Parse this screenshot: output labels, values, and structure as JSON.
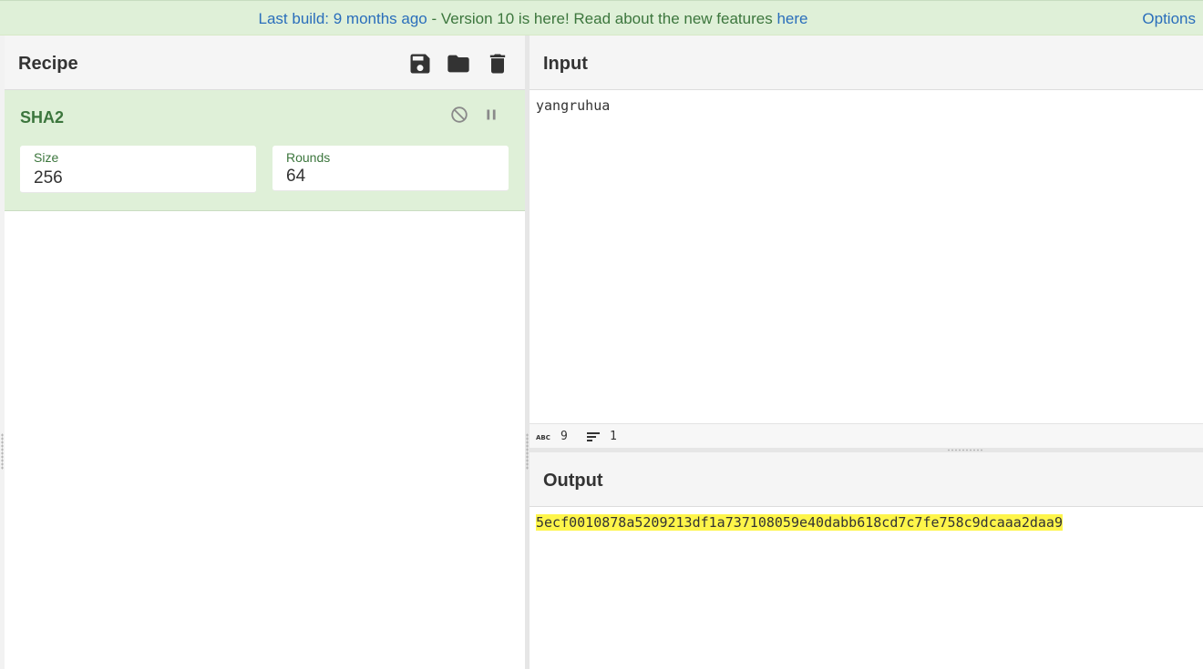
{
  "banner": {
    "prefix": "Last build: 9 months ago",
    "middle": " - Version 10 is here! Read about the new features ",
    "link": "here",
    "options": "Options"
  },
  "recipe": {
    "title": "Recipe",
    "operation": {
      "name": "SHA2",
      "args": [
        {
          "label": "Size",
          "value": "256"
        },
        {
          "label": "Rounds",
          "value": "64"
        }
      ]
    }
  },
  "input": {
    "title": "Input",
    "text": "yangruhua",
    "stats": {
      "chars": "9",
      "lines": "1"
    }
  },
  "output": {
    "title": "Output",
    "text": "5ecf0010878a5209213df1a737108059e40dabb618cd7c7fe758c9dcaaa2daa9"
  },
  "colors": {
    "banner_bg": "#dff0d8",
    "op_bg": "#dff0d8",
    "op_title": "#3c763d",
    "link": "#2a6ebb",
    "highlight": "#fef54a"
  }
}
